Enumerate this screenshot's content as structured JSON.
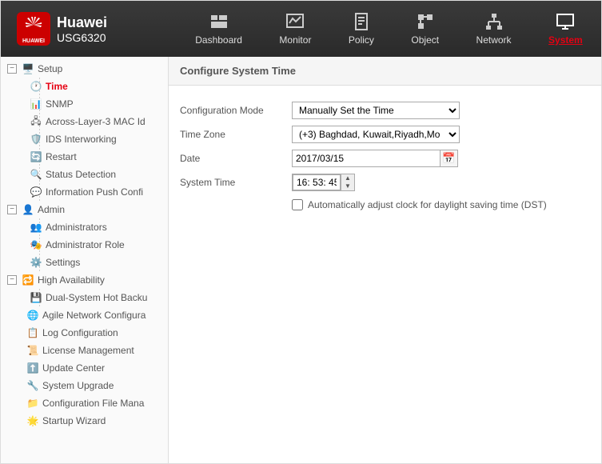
{
  "header": {
    "brand": "Huawei",
    "model": "USG6320",
    "logo_text": "HUAWEI",
    "nav": [
      {
        "label": "Dashboard"
      },
      {
        "label": "Monitor"
      },
      {
        "label": "Policy"
      },
      {
        "label": "Object"
      },
      {
        "label": "Network"
      },
      {
        "label": "System"
      }
    ]
  },
  "sidebar": {
    "setup": {
      "label": "Setup",
      "children": {
        "time": "Time",
        "snmp": "SNMP",
        "across": "Across-Layer-3 MAC Id",
        "ids": "IDS Interworking",
        "restart": "Restart",
        "status": "Status Detection",
        "info_push": "Information Push Confi"
      }
    },
    "admin": {
      "label": "Admin",
      "children": {
        "admins": "Administrators",
        "role": "Administrator Role",
        "settings": "Settings"
      }
    },
    "ha": {
      "label": "High Availability",
      "children": {
        "dual": "Dual-System Hot Backu"
      }
    },
    "agile": "Agile Network Configura",
    "log": "Log Configuration",
    "license": "License Management",
    "update": "Update Center",
    "upgrade": "System Upgrade",
    "config_file": "Configuration File Mana",
    "startup": "Startup Wizard"
  },
  "content": {
    "title": "Configure System Time",
    "labels": {
      "mode": "Configuration Mode",
      "tz": "Time Zone",
      "date": "Date",
      "time": "System Time"
    },
    "values": {
      "mode": "Manually Set the Time",
      "tz": "(+3) Baghdad, Kuwait,Riyadh,Mo",
      "date": "2017/03/15",
      "time": "16: 53: 45"
    },
    "dst_label": "Automatically adjust clock for daylight saving time (DST)",
    "dst_checked": false
  }
}
